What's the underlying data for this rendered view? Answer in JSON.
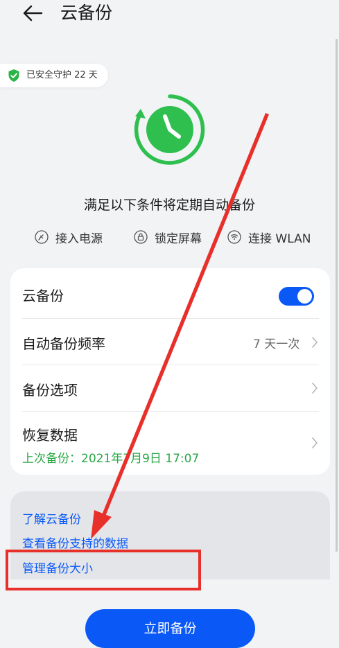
{
  "header": {
    "back_icon": "arrow-left-icon",
    "title": "云备份"
  },
  "badge": {
    "icon": "shield-check-icon",
    "text": "已安全守护 22 天"
  },
  "conditions": {
    "title": "满足以下条件将定期自动备份",
    "items": [
      {
        "icon": "power-plug-icon",
        "label": "接入电源"
      },
      {
        "icon": "lock-icon",
        "label": "锁定屏幕"
      },
      {
        "icon": "wifi-icon",
        "label": "连接 WLAN"
      }
    ]
  },
  "settings": {
    "cloud_backup": {
      "label": "云备份",
      "enabled": true
    },
    "frequency": {
      "label": "自动备份频率",
      "value": "7 天一次"
    },
    "options": {
      "label": "备份选项"
    },
    "restore": {
      "label": "恢复数据",
      "last_backup": "上次备份：2021年7月9日 17:07"
    }
  },
  "links": [
    {
      "label": "了解云备份"
    },
    {
      "label": "查看备份支持的数据"
    },
    {
      "label": "管理备份大小"
    }
  ],
  "backup_button": {
    "label": "立即备份"
  },
  "colors": {
    "accent": "#0a59f7",
    "green": "#28a745",
    "annotation_red": "#e8302b",
    "background": "#f1f3f5"
  }
}
